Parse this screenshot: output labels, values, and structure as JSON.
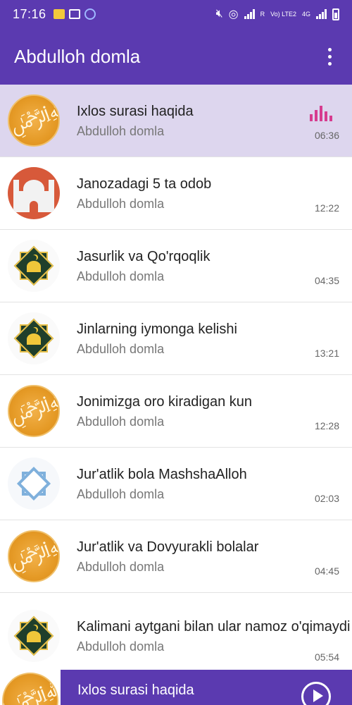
{
  "status_bar": {
    "time": "17:16",
    "network": "Vo) LTE2",
    "network_type": "4G",
    "roaming_marker": "R"
  },
  "app_bar": {
    "title": "Abdulloh domla"
  },
  "tracks": [
    {
      "title": "Ixlos surasi haqida",
      "artist": "Abdulloh domla",
      "duration": "06:36",
      "thumb": "calligraphy",
      "playing": true
    },
    {
      "title": "Janozadagi 5 ta odob",
      "artist": "Abdulloh domla",
      "duration": "12:22",
      "thumb": "mosque"
    },
    {
      "title": "Jasurlik va Qo'rqoqlik",
      "artist": "Abdulloh domla",
      "duration": "04:35",
      "thumb": "star"
    },
    {
      "title": "Jinlarning iymonga kelishi",
      "artist": "Abdulloh domla",
      "duration": "13:21",
      "thumb": "star"
    },
    {
      "title": "Jonimizga oro kiradigan kun",
      "artist": "Abdulloh domla",
      "duration": "12:28",
      "thumb": "calligraphy"
    },
    {
      "title": "Jur'atlik bola MashshaAlloh",
      "artist": "Abdulloh domla",
      "duration": "02:03",
      "thumb": "lattice"
    },
    {
      "title": "Jur'atlik va Dovyurakli bolalar",
      "artist": "Abdulloh domla",
      "duration": "04:45",
      "thumb": "calligraphy"
    },
    {
      "title": "Kalimani aytgani bilan ular namoz o'qimaydi",
      "artist": "Abdulloh domla",
      "duration": "05:54",
      "thumb": "star"
    }
  ],
  "now_playing": {
    "title": "Ixlos surasi haqida"
  },
  "colors": {
    "primary": "#5b3ab0",
    "active_row": "#ddd6ee",
    "equalizer": "#d63c8f"
  }
}
